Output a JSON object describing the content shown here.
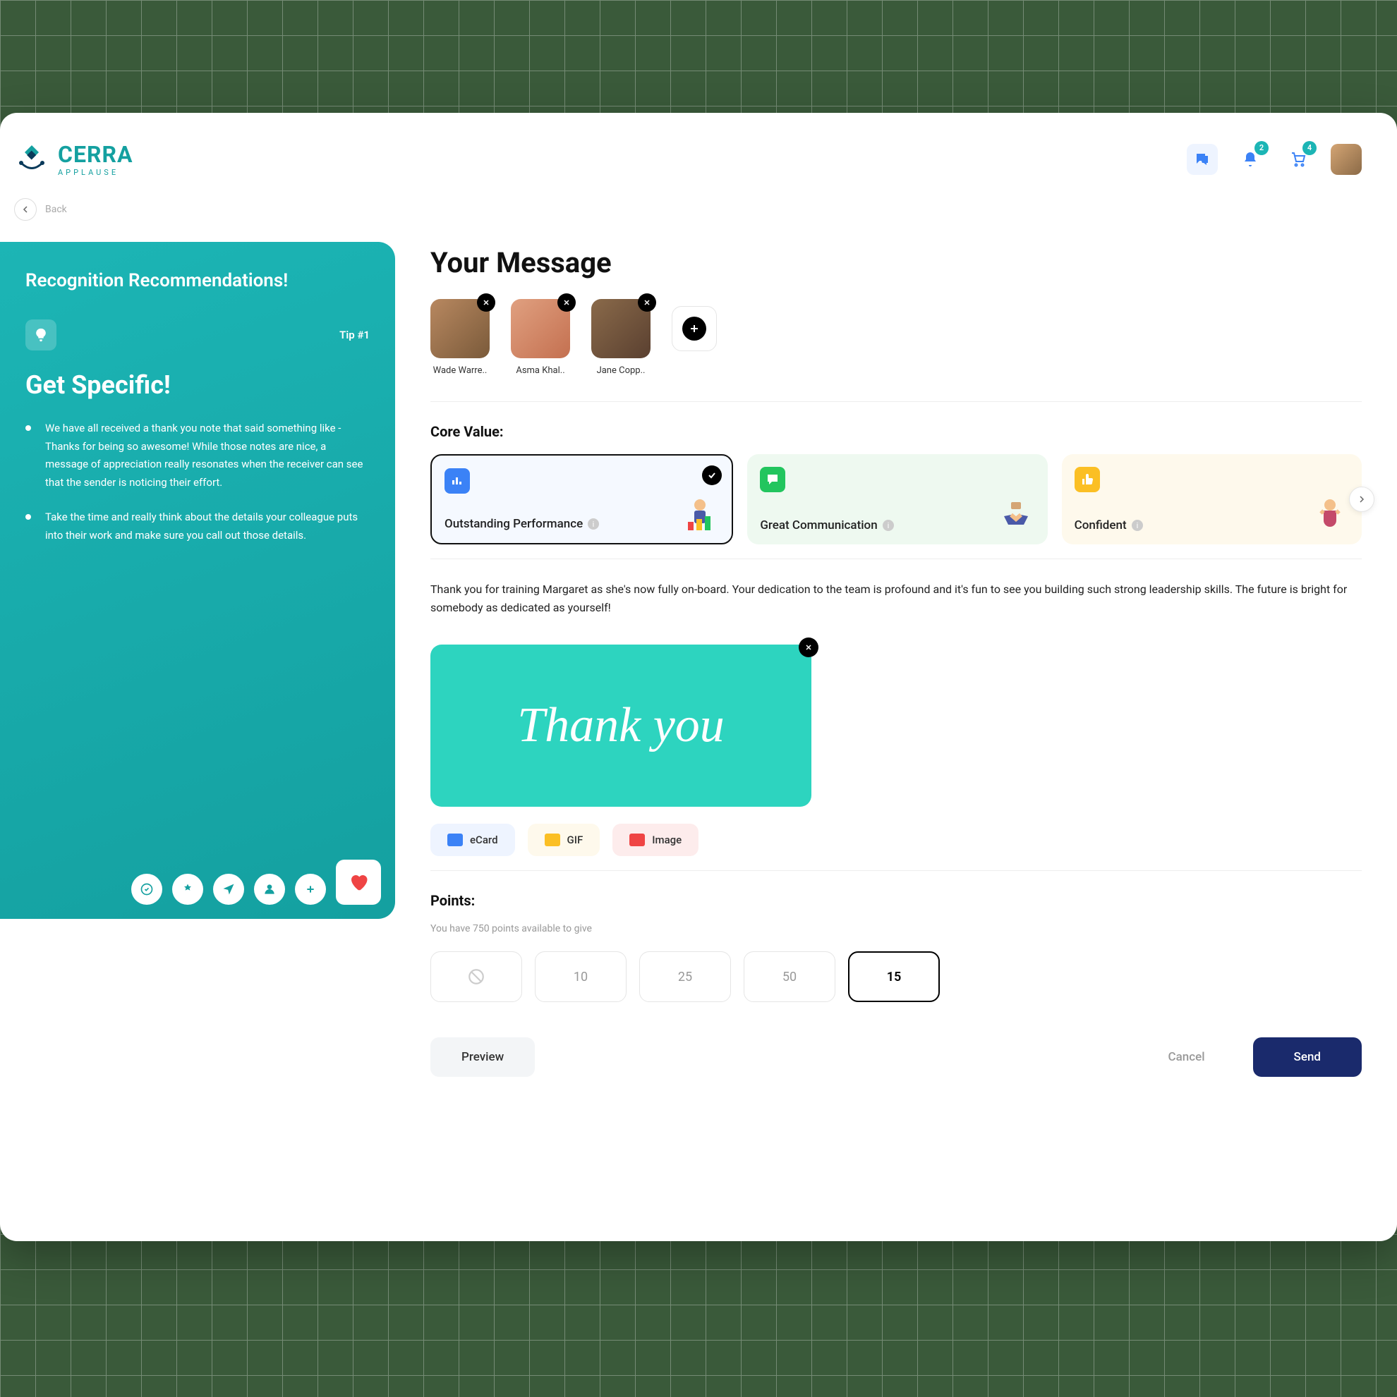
{
  "brand": {
    "name": "CERRA",
    "subtitle": "APPLAUSE"
  },
  "header": {
    "notifications_badge": "2",
    "cart_badge": "4"
  },
  "backLabel": "Back",
  "tips": {
    "title": "Recognition Recommendations!",
    "tipNumber": "Tip #1",
    "heading": "Get Specific!",
    "bullets": [
      "We have all received a thank you note that said something like - Thanks for being so awesome! While those notes are nice, a message of appreciation really resonates when the receiver can see that the sender is noticing their effort.",
      "Take the time and really think about the details your colleague puts into their work and make sure you call out those details."
    ]
  },
  "message": {
    "title": "Your Message",
    "recipients": [
      {
        "name": "Wade Warre.."
      },
      {
        "name": "Asma Khal.."
      },
      {
        "name": "Jane Copp.."
      }
    ],
    "coreValueLabel": "Core Value:",
    "coreValues": [
      {
        "name": "Outstanding Performance",
        "selected": true
      },
      {
        "name": "Great Communication",
        "selected": false
      },
      {
        "name": "Confident",
        "selected": false
      }
    ],
    "body": "Thank you for training Margaret as she's now fully on-board. Your dedication to the team is profound and it's fun to see you building such strong leadership skills. The future is bright for somebody as dedicated as yourself!",
    "thanksCard": "Thank you",
    "mediaTabs": {
      "ecard": "eCard",
      "gif": "GIF",
      "image": "Image"
    },
    "pointsLabel": "Points:",
    "pointsSub": "You have 750 points available to give",
    "pointOptions": [
      "10",
      "25",
      "50"
    ],
    "pointCustom": "15",
    "actions": {
      "preview": "Preview",
      "cancel": "Cancel",
      "send": "Send"
    }
  }
}
